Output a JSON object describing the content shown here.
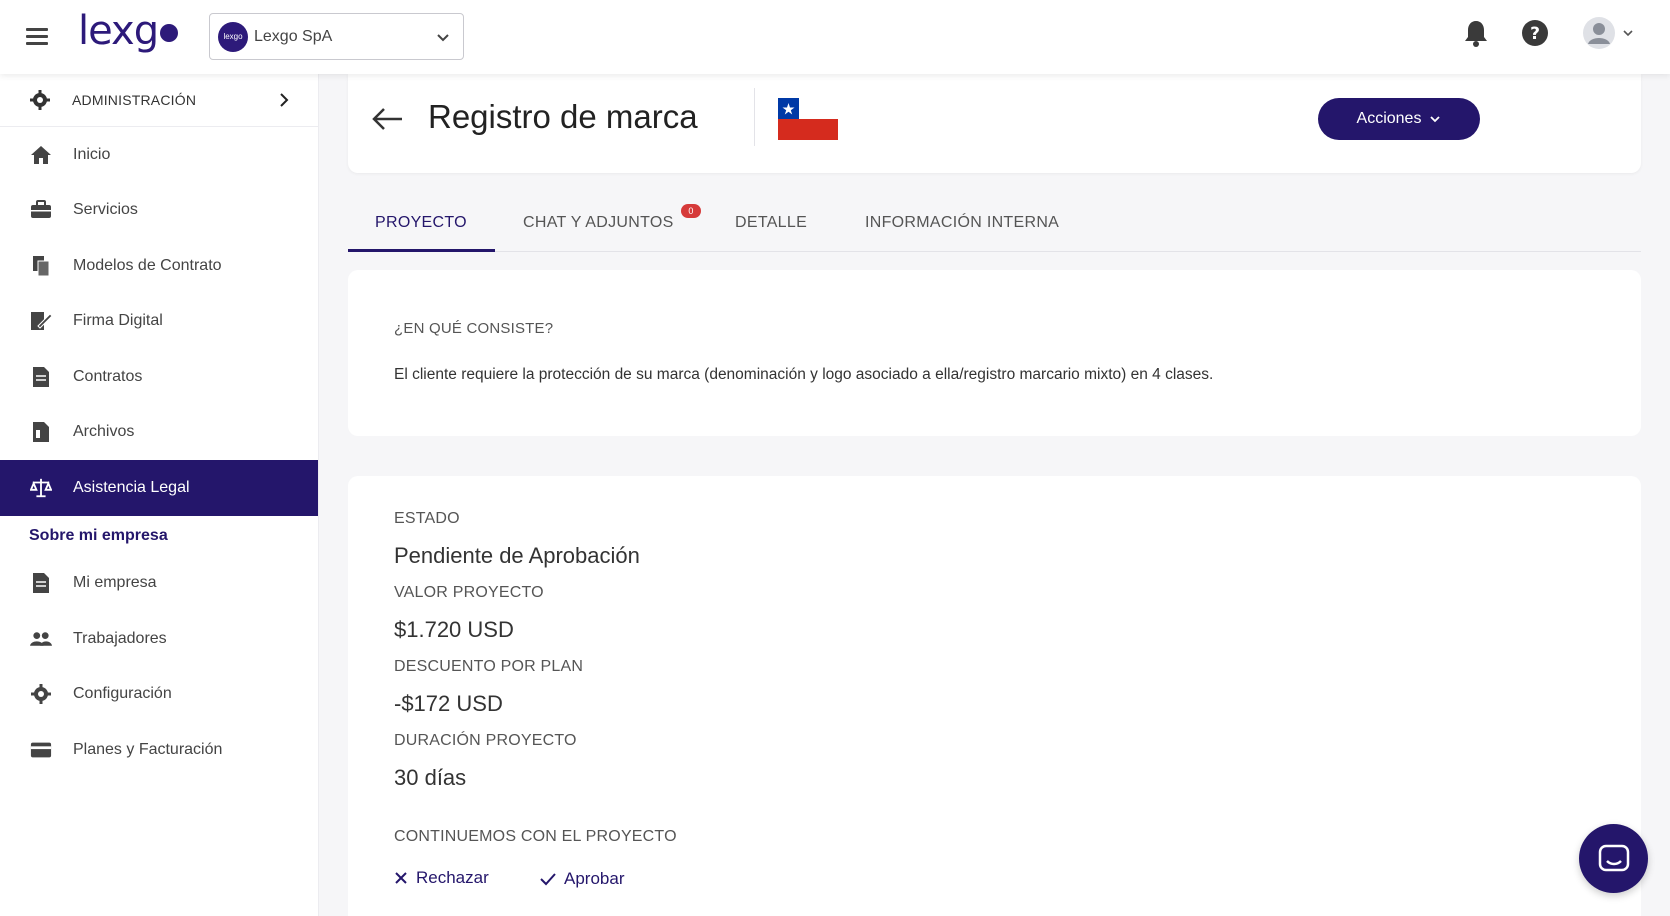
{
  "topbar": {
    "logo_text": "lexg",
    "company": {
      "avatar_text": "lexgo",
      "name": "Lexgo SpA"
    },
    "icons": [
      "hamburger-icon",
      "bell-icon",
      "help-icon",
      "user-avatar-icon"
    ]
  },
  "sidebar": {
    "admin_label": "ADMINISTRACIÓN",
    "items": [
      {
        "label": "Inicio",
        "icon": "home-icon"
      },
      {
        "label": "Servicios",
        "icon": "briefcase-icon"
      },
      {
        "label": "Modelos de Contrato",
        "icon": "copy-icon"
      },
      {
        "label": "Firma Digital",
        "icon": "signature-icon"
      },
      {
        "label": "Contratos",
        "icon": "document-icon"
      },
      {
        "label": "Archivos",
        "icon": "file-icon"
      },
      {
        "label": "Asistencia Legal",
        "icon": "scale-icon",
        "active": true
      }
    ],
    "section_title": "Sobre mi empresa",
    "company_items": [
      {
        "label": "Mi empresa",
        "icon": "document-icon"
      },
      {
        "label": "Trabajadores",
        "icon": "users-icon"
      },
      {
        "label": "Configuración",
        "icon": "gear-icon"
      },
      {
        "label": "Planes y Facturación",
        "icon": "credit-card-icon"
      }
    ]
  },
  "header": {
    "title": "Registro de marca",
    "actions_label": "Acciones"
  },
  "tabs": [
    {
      "label": "PROYECTO",
      "active": true
    },
    {
      "label": "CHAT Y ADJUNTOS",
      "badge": "0"
    },
    {
      "label": "DETALLE"
    },
    {
      "label": "INFORMACIÓN INTERNA"
    }
  ],
  "summary": {
    "heading": "¿EN QUÉ CONSISTE?",
    "text": "El cliente requiere la protección de su marca (denominación y logo asociado a ella/registro marcario mixto) en 4 clases."
  },
  "project": {
    "status_label": "ESTADO",
    "status_value": "Pendiente de Aprobación",
    "value_label": "VALOR PROYECTO",
    "value_value": "$1.720 USD",
    "discount_label": "DESCUENTO POR PLAN",
    "discount_value": "-$172 USD",
    "duration_label": "DURACIÓN PROYECTO",
    "duration_value": "30 días",
    "continue_label": "CONTINUEMOS CON EL PROYECTO",
    "reject_label": "Rechazar",
    "approve_label": "Aprobar"
  },
  "colors": {
    "brand": "#24166b",
    "badge": "#d63a3a",
    "flag_red": "#d52b1e",
    "flag_blue": "#0039a6"
  }
}
